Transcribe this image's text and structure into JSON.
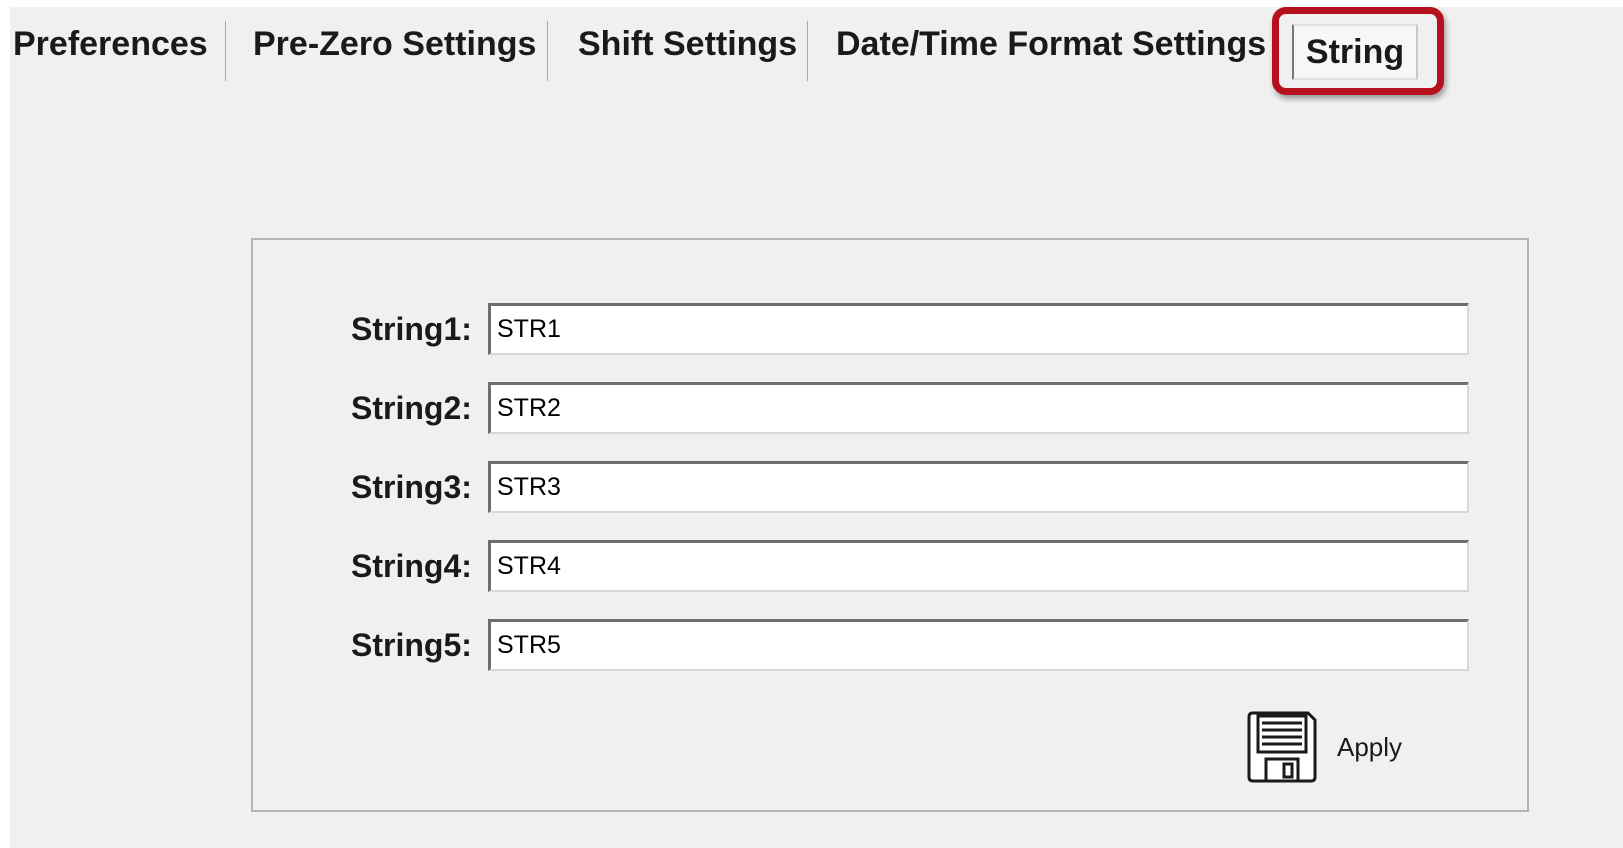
{
  "tabs": [
    {
      "label": "Preferences"
    },
    {
      "label": "Pre-Zero Settings"
    },
    {
      "label": "Shift Settings"
    },
    {
      "label": "Date/Time Format Settings"
    },
    {
      "label": "String"
    }
  ],
  "active_tab": "String",
  "strings": [
    {
      "label": "String1:",
      "value": "STR1"
    },
    {
      "label": "String2:",
      "value": "STR2"
    },
    {
      "label": "String3:",
      "value": "STR3"
    },
    {
      "label": "String4:",
      "value": "STR4"
    },
    {
      "label": "String5:",
      "value": "STR5"
    }
  ],
  "apply": {
    "label": "Apply",
    "icon": "floppy-disk-icon"
  },
  "colors": {
    "highlight": "#b5101c",
    "background": "#f0f0f0"
  }
}
